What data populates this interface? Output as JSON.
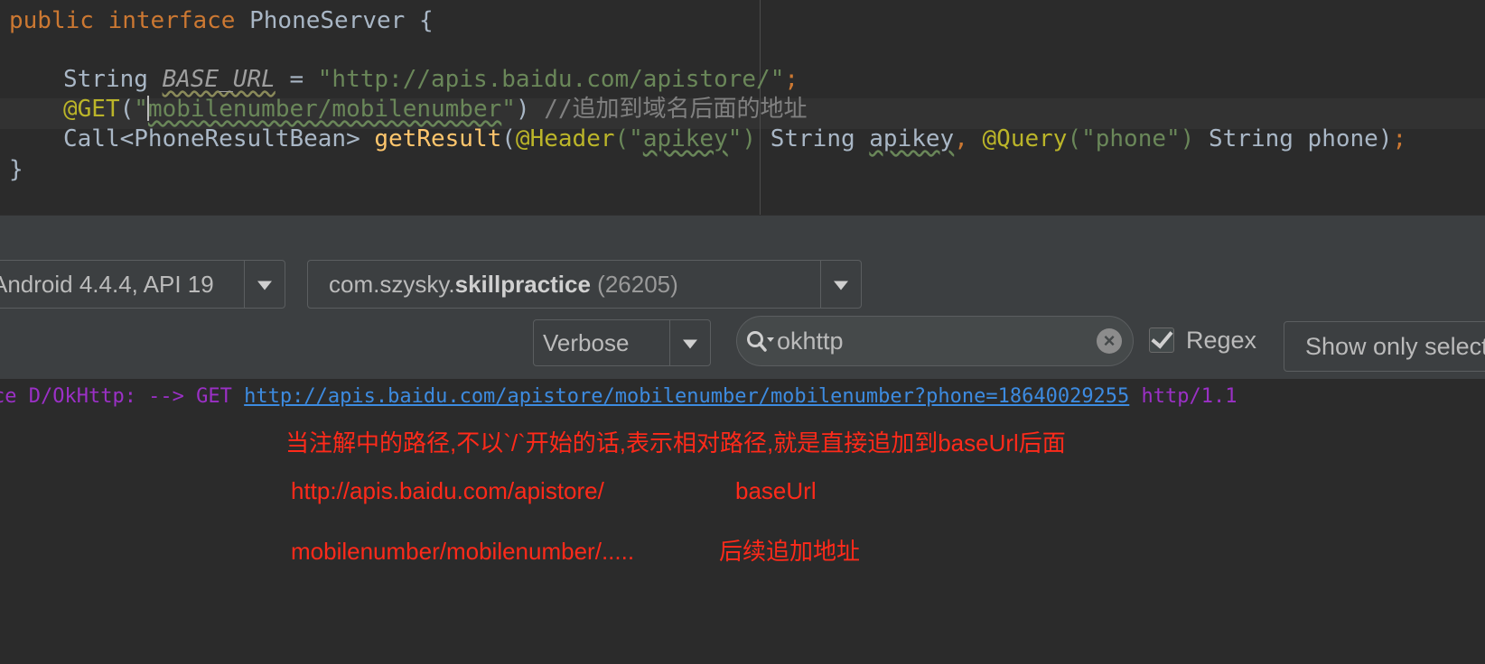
{
  "editor": {
    "line1": {
      "kw1": "public",
      "kw2": "interface",
      "name": "PhoneServer {"
    },
    "line3": {
      "type": "String",
      "const": "BASE_URL",
      "eq": " = ",
      "value": "\"http://apis.baidu.com/apistore/\"",
      "semi": ";"
    },
    "line4": {
      "ann": "@GET",
      "open": "(",
      "quote_open": "\"",
      "path": "mobilenumber/mobilenumber",
      "quote_close": "\"",
      "close": ")",
      "comment": " //追加到域名后面的地址"
    },
    "line5": {
      "call": "Call<PhoneResultBean> ",
      "method": "getResult",
      "p1": "(",
      "ann1": "@Header",
      "a1open": "(\"",
      "a1val": "apikey",
      "a1close": "\")",
      "mid": " String ",
      "param1": "apikey",
      "comma": ", ",
      "ann2": "@Query",
      "a2": "(\"phone\")",
      "end": " String phone)",
      "semi": ";"
    },
    "line6": {
      "brace": "}"
    }
  },
  "toolbar": {
    "device": "Android 4.4.4, API 19",
    "process_pkg": "com.szysky.",
    "process_name": "skillpractice",
    "process_pid": " (26205)",
    "log_level": "Verbose",
    "search_value": "okhttp",
    "regex_label": "Regex",
    "regex_checked": true,
    "filter_button": "Show only selected application"
  },
  "log": {
    "prefix": "ce D/OkHttp: --> GET ",
    "url": "http://apis.baidu.com/apistore/mobilenumber/mobilenumber?phone=18640029255",
    "suffix": " http/1.1"
  },
  "annotations": {
    "note1": "当注解中的路径,不以`/`开始的话,表示相对路径,就是直接追加到baseUrl后面",
    "note2a": "http://apis.baidu.com/apistore/",
    "note2b": "baseUrl",
    "note3a": "mobilenumber/mobilenumber/.....",
    "note3b": "后续追加地址"
  },
  "colors": {
    "editor_bg": "#2b2b2b",
    "keyword": "#cc7832",
    "string": "#6a8759",
    "annotation": "#bbb529",
    "method": "#ffc66d",
    "log_text": "#9b30c6",
    "log_link": "#3d8be0",
    "note": "#ff2a1a"
  }
}
